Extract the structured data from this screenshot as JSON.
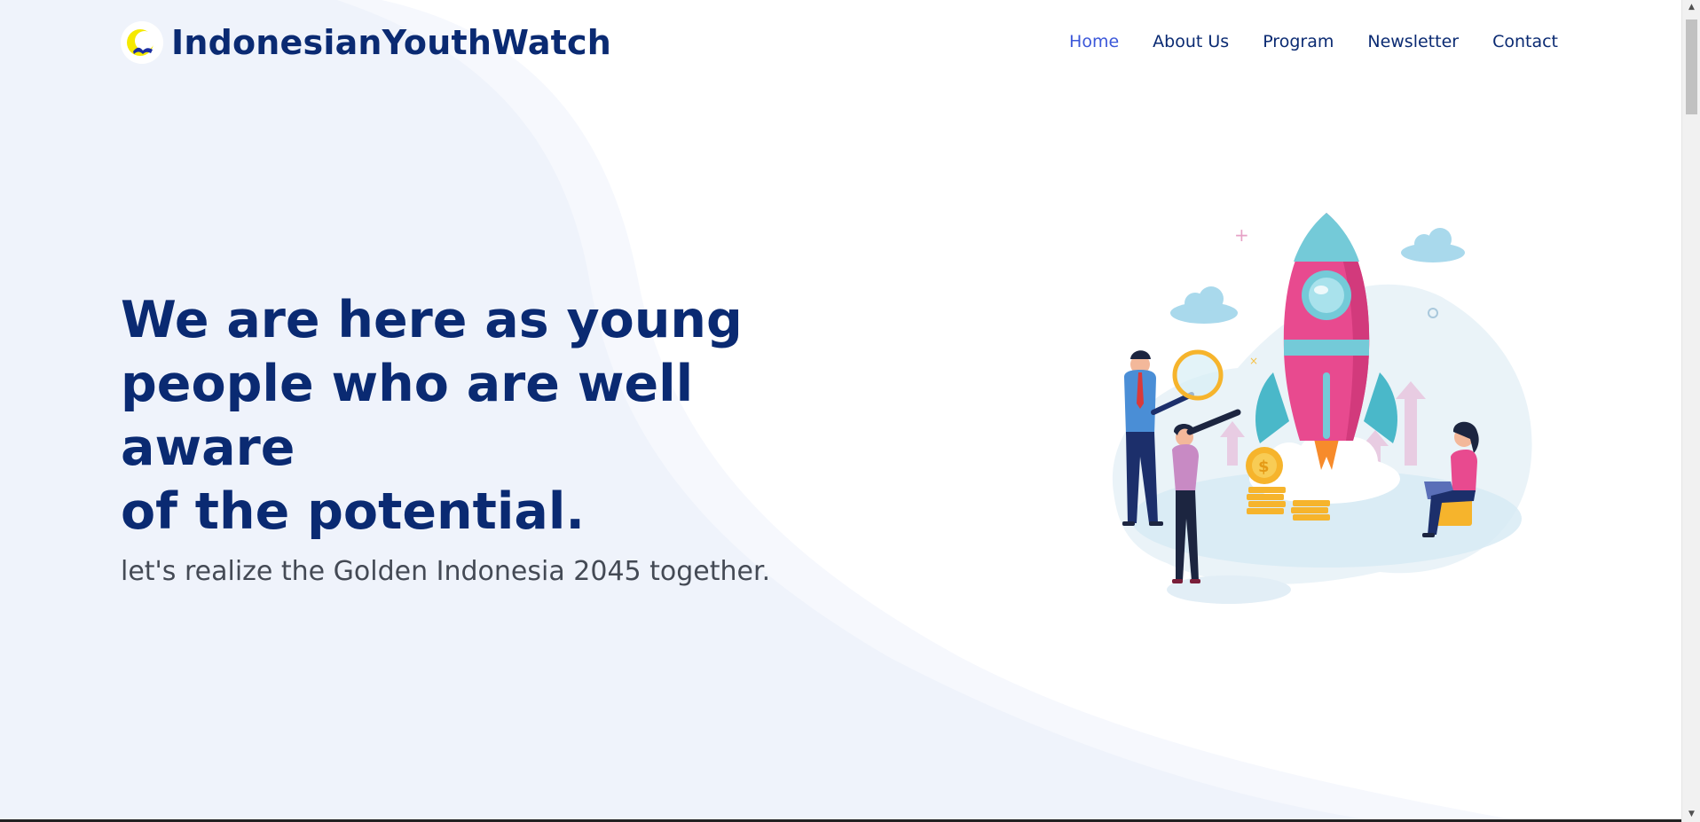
{
  "brand": {
    "name": "IndonesianYouthWatch",
    "logo_icon": "sun-crescent-logo-icon"
  },
  "nav": {
    "items": [
      {
        "label": "Home",
        "active": true
      },
      {
        "label": "About Us",
        "active": false
      },
      {
        "label": "Program",
        "active": false
      },
      {
        "label": "Newsletter",
        "active": false
      },
      {
        "label": "Contact",
        "active": false
      }
    ]
  },
  "hero": {
    "headline_line1": "We are here as young",
    "headline_line2": "people who are well aware",
    "headline_line3": "of the potential.",
    "subtitle": "let's realize the Golden Indonesia 2045 together.",
    "illustration_icon": "startup-rocket-illustration"
  },
  "colors": {
    "primary": "#0a2a72",
    "nav_active": "#3b57d9",
    "background_wave": "#eef2fb",
    "rocket": "#e84a8f"
  }
}
